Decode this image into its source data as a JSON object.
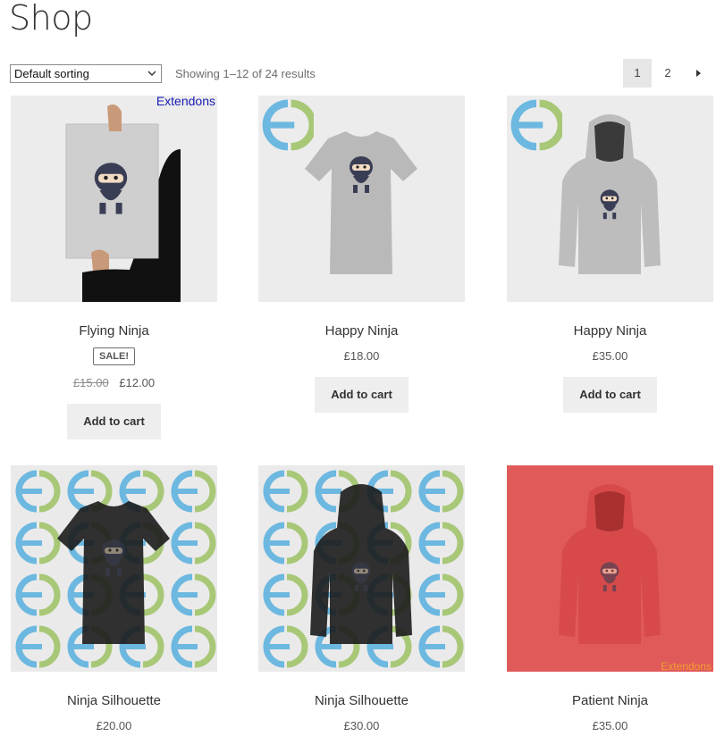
{
  "page": {
    "title": "Shop"
  },
  "toolbar": {
    "sorting_value": "Default sorting",
    "result_count": "Showing 1–12 of 24 results",
    "pages": [
      "1",
      "2"
    ],
    "current_page": "1"
  },
  "products": [
    {
      "name": "Flying Ninja",
      "badge": "SALE!",
      "old_price": "£15.00",
      "price": "£12.00",
      "button": "Add to cart",
      "watermark": "Extendons",
      "image": "poster-ninja"
    },
    {
      "name": "Happy Ninja",
      "price": "£18.00",
      "button": "Add to cart",
      "image": "tshirt-ninja"
    },
    {
      "name": "Happy Ninja",
      "price": "£35.00",
      "button": "Add to cart",
      "image": "hoodie-ninja"
    },
    {
      "name": "Ninja Silhouette",
      "price": "£20.00",
      "image": "tshirt-black-pattern"
    },
    {
      "name": "Ninja Silhouette",
      "price": "£30.00",
      "image": "hoodie-black-pattern"
    },
    {
      "name": "Patient Ninja",
      "price": "£35.00",
      "watermark": "Extendons",
      "image": "hoodie-red"
    }
  ],
  "colors": {
    "logo_blue": "#6cb8e0",
    "logo_green": "#a8c878",
    "red_overlay": "#e05a5a",
    "link_blue": "#1a1ab4",
    "watermark_orange": "#f0a030"
  }
}
